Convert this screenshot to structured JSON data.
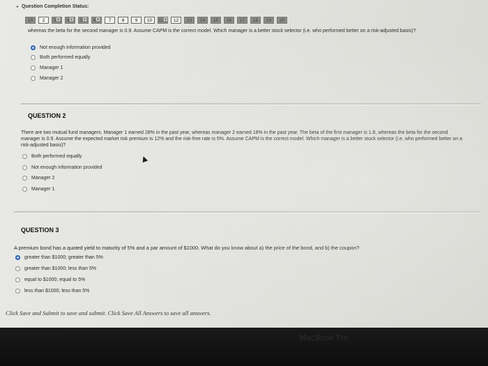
{
  "status": {
    "title": "Question Completion Status:"
  },
  "question_nav": [
    {
      "label": "10",
      "state": "done"
    },
    {
      "label": "2",
      "state": "open"
    },
    {
      "label": "3",
      "state": "done"
    },
    {
      "label": "4",
      "state": "done"
    },
    {
      "label": "5",
      "state": "done"
    },
    {
      "label": "6",
      "state": "done"
    },
    {
      "label": "7",
      "state": "open"
    },
    {
      "label": "8",
      "state": "open"
    },
    {
      "label": "9",
      "state": "open"
    },
    {
      "label": "10",
      "state": "open"
    },
    {
      "label": "11",
      "state": "done"
    },
    {
      "label": "12",
      "state": "open"
    },
    {
      "label": "13",
      "state": "done"
    },
    {
      "label": "14",
      "state": "done"
    },
    {
      "label": "15",
      "state": "done"
    },
    {
      "label": "16",
      "state": "done"
    },
    {
      "label": "17",
      "state": "done"
    },
    {
      "label": "18",
      "state": "done"
    },
    {
      "label": "19",
      "state": "done"
    },
    {
      "label": "20",
      "state": "done"
    }
  ],
  "question1": {
    "text": "whereas the beta for the second manager is 0.9. Assume CAPM is the correct model. Which manager is a better stock selector (i.e. who performed better on a risk-adjusted basis)?",
    "options": [
      "Not enough information provided",
      "Both performed equally",
      "Manager 1",
      "Manager 2"
    ],
    "selected_index": 0
  },
  "question2": {
    "title": "QUESTION 2",
    "text": "There are two mutual fund managers. Manager 1 earned 28% in the past year, whereas manager 2 earned 18% in the past year. The beta of the first manager is 1.8, whereas the beta for the second manager is 0.9. Assume the expected market risk premium is 12% and the risk-free rate is 5%. Assume CAPM is the correct model. Which manager is a better stock selector (i.e. who performed better on a risk-adjusted basis)?",
    "options": [
      "Both performed equally",
      "Not enough information provided",
      "Manager 2",
      "Manager 1"
    ]
  },
  "question3": {
    "title": "QUESTION 3",
    "text": "A premium bond has a quoted yield to maturity of 5% and a par amount of $1000. What do you know about a) the price of the bond, and b) the coupon?",
    "options": [
      "greater than $1000; greater than 5%",
      "greater than $1000; less than 5%",
      "equal to $1000; equal to 5%",
      "less than $1000; less than 5%"
    ],
    "selected_index": 0
  },
  "footer": {
    "note": "Click Save and Submit to save and submit. Click Save All Answers to save all answers."
  },
  "bezel": {
    "logo": "MacBook Pro"
  },
  "colors": {
    "radio_selected": "#2a5fb5"
  }
}
